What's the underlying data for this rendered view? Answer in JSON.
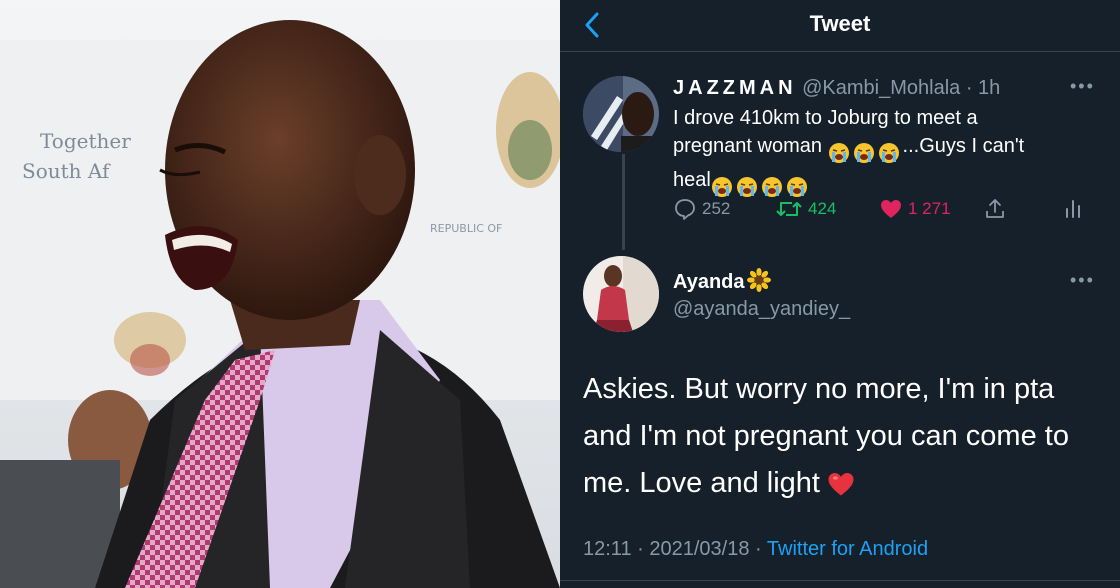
{
  "header": {
    "title": "Tweet"
  },
  "reply_tweet": {
    "display_name": "JAZZMAN",
    "handle": "@Kambi_Mohlala",
    "time": "· 1h",
    "text_line1": "I drove 410km to Joburg to meet a",
    "text_line2_start": "pregnant woman ",
    "text_line2_end": "...Guys I can't",
    "text_line3": "heal",
    "emoji_name": "loudly-crying-face",
    "stats": {
      "replies": "252",
      "retweets": "424",
      "likes": "1 271"
    },
    "colors": {
      "retweet": "#17bf63",
      "like": "#e0245e"
    }
  },
  "main_tweet": {
    "display_name": "Ayanda",
    "name_emoji": "sunflower",
    "handle": "@ayanda_yandiey_",
    "text": "Askies. But worry no more, I'm in pta and I'm not pregnant you can come to me. Love and light",
    "text_emoji": "red-heart",
    "time": "12:11",
    "date": "2021/03/18",
    "source": "Twitter for Android"
  },
  "theme": {
    "background": "#15202b",
    "divider": "#38444d",
    "muted": "#8899a6",
    "accent": "#1da1f2"
  }
}
